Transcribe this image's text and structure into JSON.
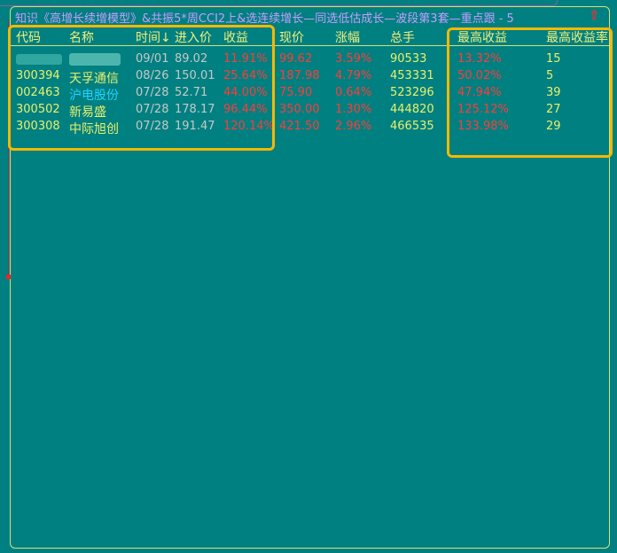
{
  "title": {
    "text": "知识《高增长续增模型》&共振5*周CCI2上&选连续增长—同选低估成长—波段第3套—重点跟",
    "count": "- 5",
    "arrow": "⇧"
  },
  "columns": [
    "代码",
    "名称",
    "时间↓",
    "进入价",
    "收益",
    "现价",
    "涨幅",
    "总手",
    "最高收益",
    "最高收益率"
  ],
  "rows": [
    {
      "code": "",
      "name": "",
      "time": "09/01",
      "entry": "89.02",
      "gain": "11.91%",
      "now": "99.62",
      "chg": "3.59%",
      "vol": "90533",
      "max_gain": "13.32%",
      "max_rate": "15",
      "name_color": "yellow"
    },
    {
      "code": "300394",
      "name": "天孚通信",
      "time": "08/26",
      "entry": "150.01",
      "gain": "25.64%",
      "now": "187.98",
      "chg": "4.79%",
      "vol": "453331",
      "max_gain": "50.02%",
      "max_rate": "5",
      "name_color": "yellow"
    },
    {
      "code": "002463",
      "name": "沪电股份",
      "time": "07/28",
      "entry": "52.71",
      "gain": "44.00%",
      "now": "75.90",
      "chg": "0.64%",
      "vol": "523296",
      "max_gain": "47.94%",
      "max_rate": "39",
      "name_color": "cyan"
    },
    {
      "code": "300502",
      "name": "新易盛",
      "time": "07/28",
      "entry": "178.17",
      "gain": "96.44%",
      "now": "350.00",
      "chg": "1.30%",
      "vol": "444820",
      "max_gain": "125.12%",
      "max_rate": "27",
      "name_color": "yellow"
    },
    {
      "code": "300308",
      "name": "中际旭创",
      "time": "07/28",
      "entry": "191.47",
      "gain": "120.14%",
      "now": "421.50",
      "chg": "2.96%",
      "vol": "466535",
      "max_gain": "133.98%",
      "max_rate": "29",
      "name_color": "yellow"
    }
  ],
  "colors": {
    "background": "#008080",
    "header": "#f2f07a",
    "up": "#ff3b3b",
    "highlight": "#f5b800"
  }
}
